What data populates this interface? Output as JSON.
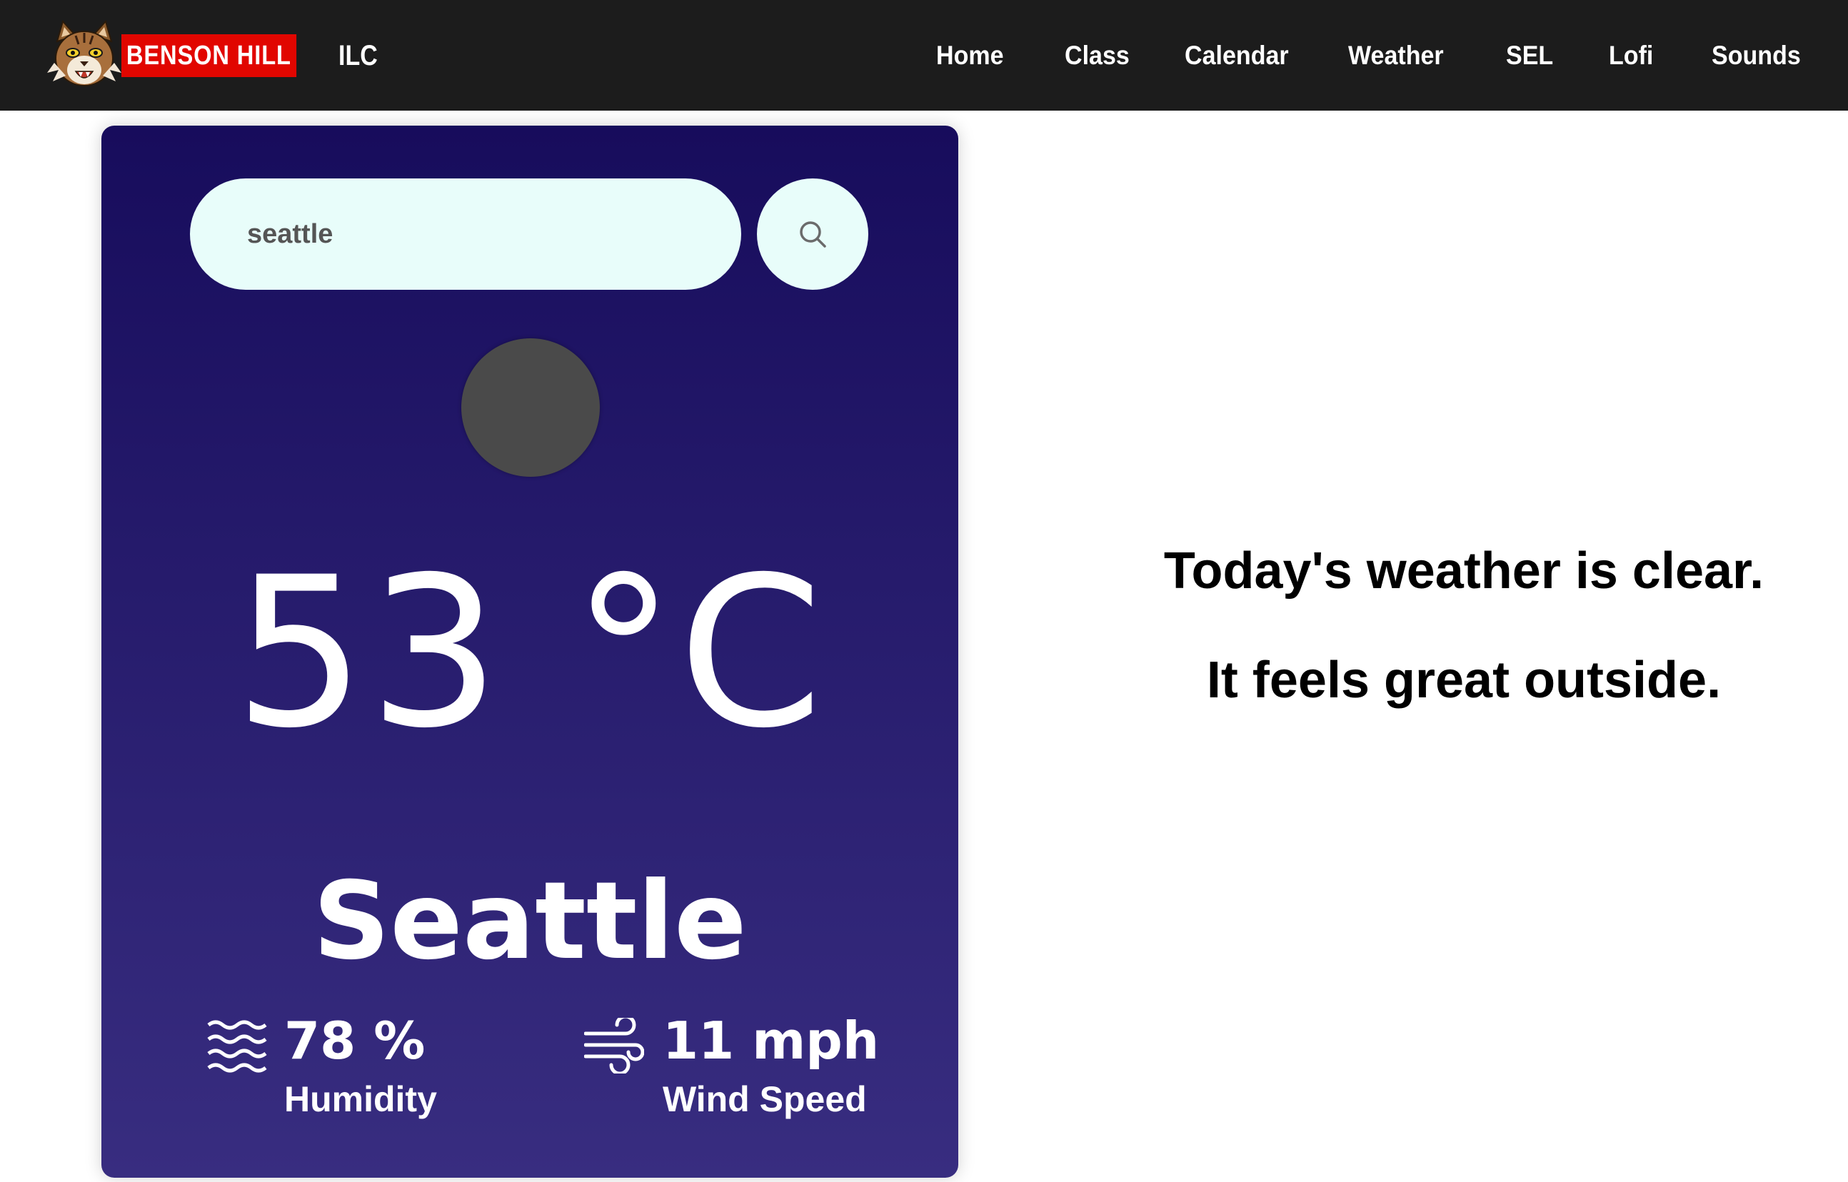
{
  "header": {
    "logo": {
      "icon": "bobcat-mascot-icon",
      "badge_text": "BENSON HILL",
      "suffix_text": "ILC",
      "badge_color": "#e10600"
    },
    "nav": [
      {
        "label": "Home"
      },
      {
        "label": "Class"
      },
      {
        "label": "Calendar"
      },
      {
        "label": "Weather"
      },
      {
        "label": "SEL"
      },
      {
        "label": "Lofi"
      },
      {
        "label": "Sounds"
      }
    ],
    "background_color": "#1c1c1c"
  },
  "weather_card": {
    "search": {
      "value": "seattle",
      "button_icon": "search-icon"
    },
    "condition_icon": "clear-weather-icon",
    "temperature": "53 °C",
    "city": "Seattle",
    "humidity": {
      "icon": "humidity-waves-icon",
      "value": "78 %",
      "label": "Humidity"
    },
    "wind": {
      "icon": "wind-icon",
      "value": "11 mph",
      "label": "Wind Speed"
    },
    "gradient_top": "#170c5c",
    "gradient_bottom": "#382d80",
    "search_bg": "#e8fdfa"
  },
  "message": {
    "line1": "Today's weather is clear.",
    "line2": "It feels great outside."
  }
}
